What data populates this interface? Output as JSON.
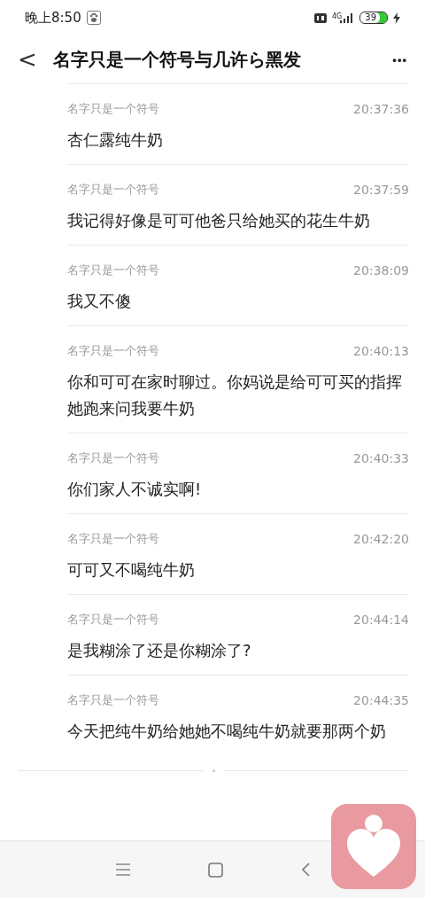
{
  "status_bar": {
    "time": "晚上8:50",
    "network": "4G",
    "battery": "39"
  },
  "header": {
    "back": "<",
    "title": "名字只是一个符号与几许ら黑发",
    "more": "•••"
  },
  "messages": [
    {
      "sender": "名字只是一个符号",
      "time": "20:37:36",
      "text": "杏仁露纯牛奶"
    },
    {
      "sender": "名字只是一个符号",
      "time": "20:37:59",
      "text": "我记得好像是可可他爸只给她买的花生牛奶"
    },
    {
      "sender": "名字只是一个符号",
      "time": "20:38:09",
      "text": "我又不傻"
    },
    {
      "sender": "名字只是一个符号",
      "time": "20:40:13",
      "text": "你和可可在家时聊过。你妈说是给可可买的指挥她跑来问我要牛奶"
    },
    {
      "sender": "名字只是一个符号",
      "time": "20:40:33",
      "text": "你们家人不诚实啊!"
    },
    {
      "sender": "名字只是一个符号",
      "time": "20:42:20",
      "text": "可可又不喝纯牛奶"
    },
    {
      "sender": "名字只是一个符号",
      "time": "20:44:14",
      "text": "是我糊涂了还是你糊涂了?"
    },
    {
      "sender": "名字只是一个符号",
      "time": "20:44:35",
      "text": "今天把纯牛奶给她她不喝纯牛奶就要那两个奶"
    }
  ]
}
